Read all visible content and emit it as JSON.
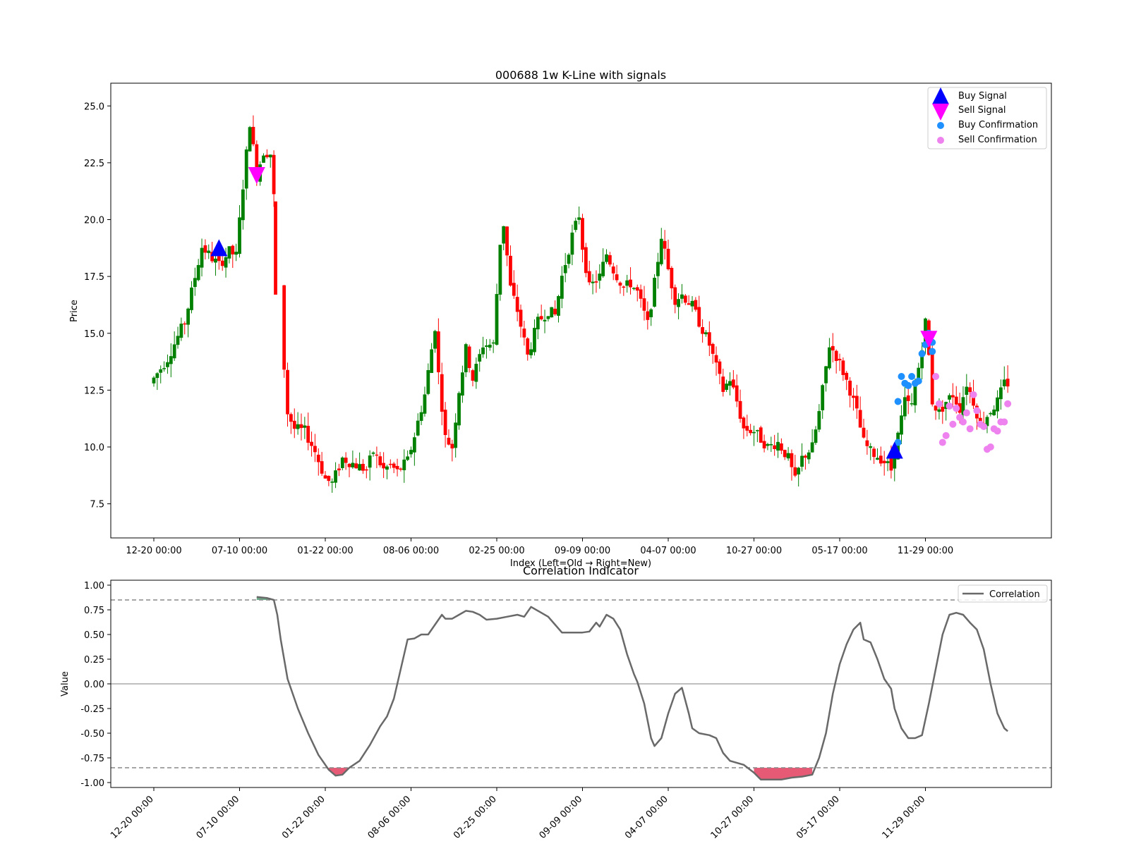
{
  "chart_data": [
    {
      "type": "candlestick",
      "title": "000688 1w K-Line with signals",
      "xlabel": "Index (Left=Old → Right=New)",
      "ylabel": "Price",
      "ylim": [
        6.0,
        26.0
      ],
      "y_ticks": [
        "7.5",
        "10.0",
        "12.5",
        "15.0",
        "17.5",
        "20.0",
        "22.5",
        "25.0"
      ],
      "x_tick_labels": [
        "12-20 00:00",
        "07-10 00:00",
        "01-22 00:00",
        "08-06 00:00",
        "02-25 00:00",
        "09-09 00:00",
        "04-07 00:00",
        "10-27 00:00",
        "05-17 00:00",
        "11-29 00:00"
      ],
      "x_tick_index": [
        0,
        25,
        50,
        75,
        100,
        125,
        150,
        175,
        200,
        225
      ],
      "bar_count": 250,
      "up_color": "#008000",
      "down_color": "#ff0000",
      "price_path": [
        [
          0,
          12.8
        ],
        [
          5,
          13.9
        ],
        [
          10,
          15.5
        ],
        [
          15,
          18.8
        ],
        [
          18,
          18.3
        ],
        [
          20,
          18.0
        ],
        [
          23,
          18.6
        ],
        [
          25,
          18.4
        ],
        [
          27,
          21.5
        ],
        [
          29,
          24.3
        ],
        [
          31,
          22.0
        ],
        [
          33,
          23.0
        ],
        [
          35,
          22.9
        ],
        [
          36,
          21.0
        ],
        [
          37,
          19.0
        ],
        [
          38,
          17.0
        ],
        [
          39,
          13.5
        ],
        [
          40,
          11.5
        ],
        [
          42,
          10.8
        ],
        [
          45,
          10.7
        ],
        [
          48,
          9.8
        ],
        [
          51,
          8.6
        ],
        [
          53,
          8.4
        ],
        [
          56,
          9.5
        ],
        [
          60,
          9.2
        ],
        [
          63,
          9.0
        ],
        [
          65,
          9.8
        ],
        [
          68,
          9.0
        ],
        [
          70,
          9.2
        ],
        [
          72,
          8.9
        ],
        [
          75,
          9.4
        ],
        [
          77,
          10.5
        ],
        [
          80,
          12.3
        ],
        [
          83,
          15.3
        ],
        [
          84,
          13.2
        ],
        [
          86,
          10.4
        ],
        [
          88,
          10.0
        ],
        [
          90,
          12.5
        ],
        [
          92,
          14.3
        ],
        [
          94,
          13.0
        ],
        [
          97,
          14.5
        ],
        [
          100,
          14.5
        ],
        [
          102,
          19.0
        ],
        [
          103,
          19.8
        ],
        [
          105,
          17.0
        ],
        [
          107,
          16.0
        ],
        [
          110,
          14.0
        ],
        [
          113,
          15.5
        ],
        [
          116,
          16.0
        ],
        [
          118,
          15.8
        ],
        [
          120,
          17.5
        ],
        [
          123,
          19.3
        ],
        [
          125,
          20.2
        ],
        [
          126,
          18.8
        ],
        [
          128,
          17.0
        ],
        [
          131,
          17.5
        ],
        [
          133,
          18.5
        ],
        [
          135,
          17.8
        ],
        [
          138,
          17.0
        ],
        [
          140,
          17.2
        ],
        [
          142,
          16.8
        ],
        [
          145,
          15.4
        ],
        [
          147,
          17.2
        ],
        [
          149,
          19.3
        ],
        [
          151,
          17.8
        ],
        [
          153,
          16.5
        ],
        [
          155,
          16.7
        ],
        [
          158,
          16.2
        ],
        [
          160,
          15.5
        ],
        [
          163,
          14.5
        ],
        [
          165,
          13.5
        ],
        [
          167,
          12.5
        ],
        [
          169,
          13.0
        ],
        [
          171,
          12.0
        ],
        [
          173,
          10.8
        ],
        [
          176,
          10.7
        ],
        [
          180,
          10.0
        ],
        [
          183,
          10.2
        ],
        [
          186,
          9.5
        ],
        [
          188,
          8.5
        ],
        [
          190,
          9.5
        ],
        [
          193,
          10.0
        ],
        [
          195,
          11.5
        ],
        [
          197,
          13.5
        ],
        [
          198,
          14.5
        ],
        [
          200,
          14.0
        ],
        [
          202,
          13.3
        ],
        [
          204,
          12.5
        ],
        [
          206,
          11.5
        ],
        [
          208,
          10.2
        ],
        [
          210,
          9.8
        ],
        [
          213,
          9.5
        ],
        [
          215,
          9.2
        ],
        [
          216,
          9.0
        ],
        [
          218,
          10.5
        ],
        [
          220,
          12.0
        ],
        [
          222,
          11.8
        ],
        [
          224,
          13.5
        ],
        [
          225,
          14.5
        ],
        [
          226,
          15.5
        ],
        [
          227,
          14.0
        ],
        [
          228,
          12.0
        ],
        [
          230,
          11.5
        ],
        [
          232,
          12.0
        ],
        [
          234,
          12.3
        ],
        [
          236,
          11.7
        ],
        [
          238,
          12.8
        ],
        [
          240,
          12.0
        ],
        [
          242,
          11.0
        ],
        [
          245,
          11.6
        ],
        [
          247,
          12.0
        ],
        [
          249,
          12.8
        ]
      ],
      "buy_signals": [
        {
          "index": 19,
          "price": 18.7
        },
        {
          "index": 216,
          "price": 9.8
        }
      ],
      "sell_signals": [
        {
          "index": 30,
          "price": 22.0
        },
        {
          "index": 226,
          "price": 14.8
        }
      ],
      "buy_confirmations": [
        [
          217,
          10.2
        ],
        [
          217,
          12.0
        ],
        [
          218,
          13.1
        ],
        [
          219,
          12.8
        ],
        [
          220,
          12.7
        ],
        [
          221,
          13.1
        ],
        [
          222,
          12.8
        ],
        [
          223,
          12.9
        ],
        [
          224,
          14.1
        ],
        [
          225,
          14.5
        ],
        [
          226,
          15.0
        ],
        [
          227,
          14.6
        ],
        [
          227,
          14.2
        ]
      ],
      "sell_confirmations": [
        [
          228,
          13.1
        ],
        [
          229,
          11.9
        ],
        [
          230,
          10.2
        ],
        [
          231,
          10.5
        ],
        [
          232,
          11.8
        ],
        [
          233,
          11.0
        ],
        [
          234,
          11.7
        ],
        [
          235,
          11.3
        ],
        [
          236,
          11.1
        ],
        [
          237,
          11.5
        ],
        [
          238,
          10.8
        ],
        [
          239,
          12.3
        ],
        [
          240,
          11.6
        ],
        [
          241,
          11.0
        ],
        [
          242,
          10.9
        ],
        [
          243,
          9.9
        ],
        [
          244,
          10.0
        ],
        [
          245,
          10.8
        ],
        [
          246,
          10.7
        ],
        [
          247,
          11.1
        ],
        [
          248,
          11.1
        ],
        [
          249,
          11.9
        ]
      ],
      "legend": {
        "position": "upper right",
        "entries": [
          "Buy Signal",
          "Sell Signal",
          "Buy Confirmation",
          "Sell Confirmation"
        ],
        "colors": [
          "#0000ff",
          "#ff00ff",
          "#1e90ff",
          "#ee82ee"
        ]
      }
    },
    {
      "type": "line",
      "title": "Correlation Indicator",
      "xlabel": "",
      "ylabel": "Value",
      "ylim": [
        -1.05,
        1.05
      ],
      "y_ticks": [
        "-1.00",
        "-0.75",
        "-0.50",
        "-0.25",
        "0.00",
        "0.25",
        "0.50",
        "0.75",
        "1.00"
      ],
      "x_tick_labels": [
        "12-20 00:00",
        "07-10 00:00",
        "01-22 00:00",
        "08-06 00:00",
        "02-25 00:00",
        "09-09 00:00",
        "04-07 00:00",
        "10-27 00:00",
        "05-17 00:00",
        "11-29 00:00"
      ],
      "x_tick_index": [
        0,
        25,
        50,
        75,
        100,
        125,
        150,
        175,
        200,
        225
      ],
      "series": [
        {
          "name": "Correlation",
          "color": "#696969",
          "points": [
            [
              30,
              0.88
            ],
            [
              33,
              0.87
            ],
            [
              35,
              0.85
            ],
            [
              36,
              0.7
            ],
            [
              37,
              0.45
            ],
            [
              39,
              0.05
            ],
            [
              42,
              -0.25
            ],
            [
              45,
              -0.5
            ],
            [
              48,
              -0.72
            ],
            [
              51,
              -0.87
            ],
            [
              53,
              -0.93
            ],
            [
              55,
              -0.92
            ],
            [
              57,
              -0.85
            ],
            [
              60,
              -0.78
            ],
            [
              63,
              -0.62
            ],
            [
              66,
              -0.43
            ],
            [
              68,
              -0.33
            ],
            [
              70,
              -0.15
            ],
            [
              72,
              0.15
            ],
            [
              73,
              0.3
            ],
            [
              74,
              0.45
            ],
            [
              76,
              0.46
            ],
            [
              78,
              0.5
            ],
            [
              80,
              0.5
            ],
            [
              82,
              0.6
            ],
            [
              84,
              0.7
            ],
            [
              85,
              0.66
            ],
            [
              87,
              0.66
            ],
            [
              89,
              0.7
            ],
            [
              91,
              0.74
            ],
            [
              93,
              0.73
            ],
            [
              95,
              0.7
            ],
            [
              97,
              0.65
            ],
            [
              100,
              0.66
            ],
            [
              103,
              0.68
            ],
            [
              106,
              0.7
            ],
            [
              108,
              0.68
            ],
            [
              110,
              0.78
            ],
            [
              113,
              0.72
            ],
            [
              115,
              0.68
            ],
            [
              117,
              0.6
            ],
            [
              119,
              0.52
            ],
            [
              122,
              0.52
            ],
            [
              125,
              0.52
            ],
            [
              127,
              0.53
            ],
            [
              129,
              0.62
            ],
            [
              130,
              0.58
            ],
            [
              132,
              0.7
            ],
            [
              134,
              0.66
            ],
            [
              136,
              0.55
            ],
            [
              138,
              0.3
            ],
            [
              140,
              0.1
            ],
            [
              141,
              0.02
            ],
            [
              143,
              -0.2
            ],
            [
              145,
              -0.55
            ],
            [
              146,
              -0.63
            ],
            [
              148,
              -0.55
            ],
            [
              150,
              -0.3
            ],
            [
              152,
              -0.1
            ],
            [
              154,
              -0.04
            ],
            [
              156,
              -0.3
            ],
            [
              157,
              -0.45
            ],
            [
              159,
              -0.5
            ],
            [
              162,
              -0.52
            ],
            [
              164,
              -0.55
            ],
            [
              166,
              -0.7
            ],
            [
              168,
              -0.78
            ],
            [
              172,
              -0.82
            ],
            [
              175,
              -0.9
            ],
            [
              177,
              -0.97
            ],
            [
              180,
              -0.97
            ],
            [
              183,
              -0.97
            ],
            [
              186,
              -0.95
            ],
            [
              189,
              -0.94
            ],
            [
              192,
              -0.92
            ],
            [
              194,
              -0.75
            ],
            [
              196,
              -0.5
            ],
            [
              198,
              -0.1
            ],
            [
              200,
              0.2
            ],
            [
              202,
              0.4
            ],
            [
              204,
              0.55
            ],
            [
              206,
              0.62
            ],
            [
              207,
              0.45
            ],
            [
              209,
              0.42
            ],
            [
              211,
              0.25
            ],
            [
              213,
              0.05
            ],
            [
              215,
              -0.05
            ],
            [
              216,
              -0.25
            ],
            [
              218,
              -0.45
            ],
            [
              220,
              -0.55
            ],
            [
              222,
              -0.55
            ],
            [
              224,
              -0.52
            ],
            [
              226,
              -0.2
            ],
            [
              228,
              0.15
            ],
            [
              230,
              0.5
            ],
            [
              232,
              0.7
            ],
            [
              234,
              0.72
            ],
            [
              236,
              0.7
            ],
            [
              238,
              0.62
            ],
            [
              240,
              0.55
            ],
            [
              242,
              0.35
            ],
            [
              244,
              0.0
            ],
            [
              246,
              -0.3
            ],
            [
              248,
              -0.45
            ],
            [
              249,
              -0.48
            ]
          ]
        }
      ],
      "threshold_lines": [
        0.85,
        0.0,
        -0.85
      ],
      "fill_colors": {
        "positive": "#2e8b57",
        "negative": "#dc143c"
      },
      "legend": {
        "position": "upper right",
        "entries": [
          "Correlation"
        ]
      }
    }
  ]
}
